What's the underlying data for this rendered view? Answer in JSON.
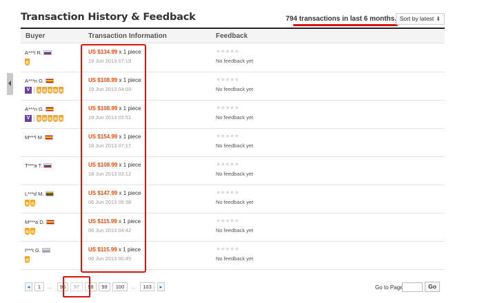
{
  "header": {
    "title": "Transaction History & Feedback",
    "summary": "794 transactions in last 6 months.",
    "sort_label": "Sort by latest"
  },
  "columns": {
    "buyer": "Buyer",
    "transaction": "Transaction Information",
    "feedback": "Feedback"
  },
  "rows": [
    {
      "buyer": "A***i R.",
      "flag": "ru",
      "price": "US $134.99",
      "qty": "x 1 piece",
      "date": "19 Jun 2013 07:19",
      "stars": "★★★★★",
      "feedback": "No feedback yet"
    },
    {
      "buyer": "A***n G.",
      "flag": "es",
      "price": "US $108.99",
      "qty": "x 1 piece",
      "date": "19 Jun 2013 04:03",
      "stars": "★★★★★",
      "feedback": "No feedback yet"
    },
    {
      "buyer": "A***n G.",
      "flag": "es",
      "price": "US $108.99",
      "qty": "x 1 piece",
      "date": "19 Jun 2013 03:51",
      "stars": "★★★★★",
      "feedback": "No feedback yet"
    },
    {
      "buyer": "M***l M.",
      "flag": "es",
      "price": "US $154.99",
      "qty": "x 1 piece",
      "date": "18 Jun 2013 07:17",
      "stars": "★★★★★",
      "feedback": "No feedback yet"
    },
    {
      "buyer": "T***a T.",
      "flag": "ru",
      "price": "US $108.99",
      "qty": "x 1 piece",
      "date": "18 Jun 2013 03:12",
      "stars": "★★★★★",
      "feedback": "No feedback yet"
    },
    {
      "buyer": "L***d M.",
      "flag": "lt",
      "price": "US $147.99",
      "qty": "x 1 piece",
      "date": "06 Jun 2013 09:38",
      "stars": "★★★★★",
      "feedback": "No feedback yet"
    },
    {
      "buyer": "M***a D.",
      "flag": "es",
      "price": "US $115.99",
      "qty": "x 1 piece",
      "date": "06 Jun 2013 04:42",
      "stars": "★★★★★",
      "feedback": "No feedback yet"
    },
    {
      "buyer": "I***t G.",
      "flag": "generic",
      "price": "US $115.99",
      "qty": "x 1 piece",
      "date": "06 Jun 2013 00:45",
      "stars": "★★★★★",
      "feedback": "No feedback yet"
    }
  ],
  "pagination": {
    "prev": "◂",
    "first": "1",
    "ellipsis": "...",
    "p96": "96",
    "p97": "97",
    "p98": "98",
    "p99": "99",
    "p100": "100",
    "last": "103",
    "next": "▸",
    "goto_label": "Go to Page",
    "goto_value": "",
    "go_label": "Go",
    "current_page": 97
  },
  "colors": {
    "price": "#e44d0f",
    "highlight": "#d9140e",
    "vip": "#6a3fa0",
    "medal": "#f0a531"
  }
}
